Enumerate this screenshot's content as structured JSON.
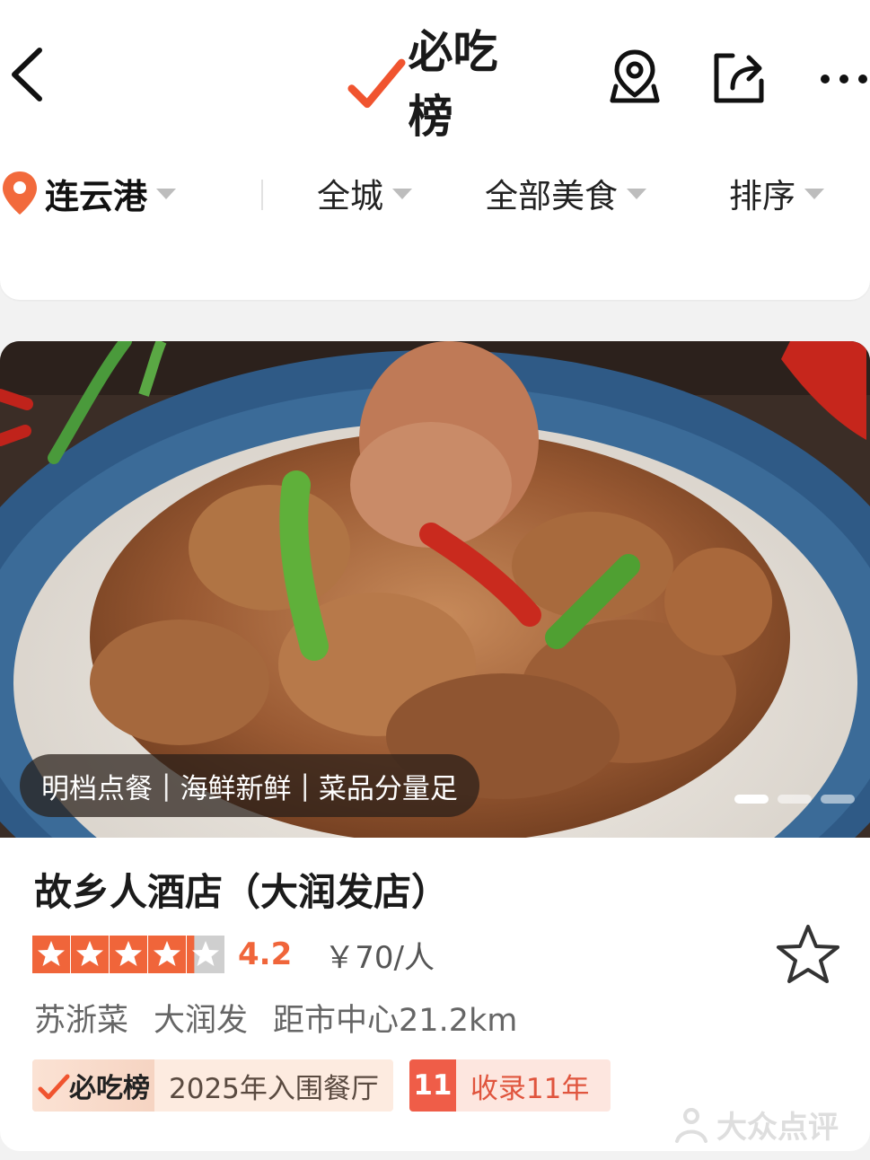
{
  "header": {
    "brand": "必吃榜",
    "icons": {
      "back": "back-arrow-icon",
      "map": "map-pin-icon",
      "share": "share-icon",
      "more": "more-dots-icon"
    }
  },
  "filters": {
    "city": "连云港",
    "area": "全城",
    "category": "全部美食",
    "sort": "排序"
  },
  "card": {
    "photo_tags": [
      "明档点餐",
      "海鲜新鲜",
      "菜品分量足"
    ],
    "carousel": {
      "count": 3,
      "active": 1
    },
    "name": "故乡人酒店（大润发店）",
    "rating_stars": 4.2,
    "score": "4.2",
    "price": "￥70/人",
    "cuisine": "苏浙菜",
    "district": "大润发",
    "distance": "距市中心21.2km",
    "rank_badge": {
      "brand": "必吃榜",
      "label": "2025年入围餐厅"
    },
    "years_badge": {
      "number": "11",
      "label": "收录11年"
    }
  },
  "watermark": "大众点评",
  "colors": {
    "accent": "#f0653a",
    "star": "#f0653a",
    "badge_red": "#ef5d48"
  }
}
